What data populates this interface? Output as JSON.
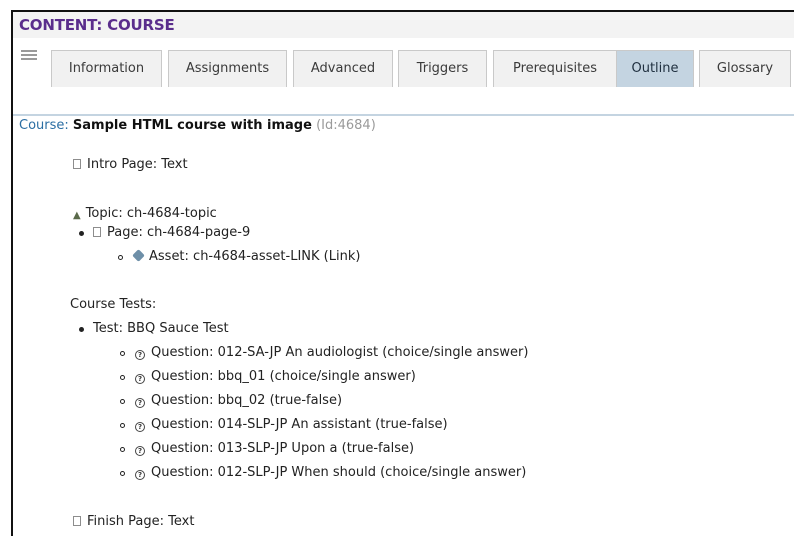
{
  "panel": {
    "title": "CONTENT: COURSE"
  },
  "tabs": [
    {
      "label": "Information"
    },
    {
      "label": "Assignments"
    },
    {
      "label": "Advanced"
    },
    {
      "label": "Triggers"
    },
    {
      "label": "Prerequisites"
    },
    {
      "label": "Outline",
      "active": true
    },
    {
      "label": "Glossary"
    }
  ],
  "course": {
    "label": "Course:",
    "name": "Sample HTML course with image",
    "id": "(Id:4684)"
  },
  "outline": {
    "intro": "Intro Page: Text",
    "topic": "Topic: ch-4684-topic",
    "page": "Page: ch-4684-page-9",
    "asset": "Asset: ch-4684-asset-LINK (Link)",
    "tests_heading": "Course Tests:",
    "test": "Test: BBQ Sauce Test",
    "questions": [
      "Question: 012-SA-JP An audiologist (choice/single answer)",
      "Question: bbq_01 (choice/single answer)",
      "Question: bbq_02 (true-false)",
      "Question: 014-SLP-JP An assistant (true-false)",
      "Question: 013-SLP-JP Upon a (true-false)",
      "Question: 012-SLP-JP When should (choice/single answer)"
    ],
    "finish": "Finish Page: Text"
  },
  "icons": {
    "menu": "list-menu-icon",
    "page": "page-icon",
    "topic": "topic-icon",
    "asset": "asset-icon",
    "question": "question-icon"
  },
  "colors": {
    "title": "#5a2d8c",
    "active_tab": "#c4d4e1",
    "course_label": "#2b6ea3",
    "muted": "#9a9a9a"
  }
}
